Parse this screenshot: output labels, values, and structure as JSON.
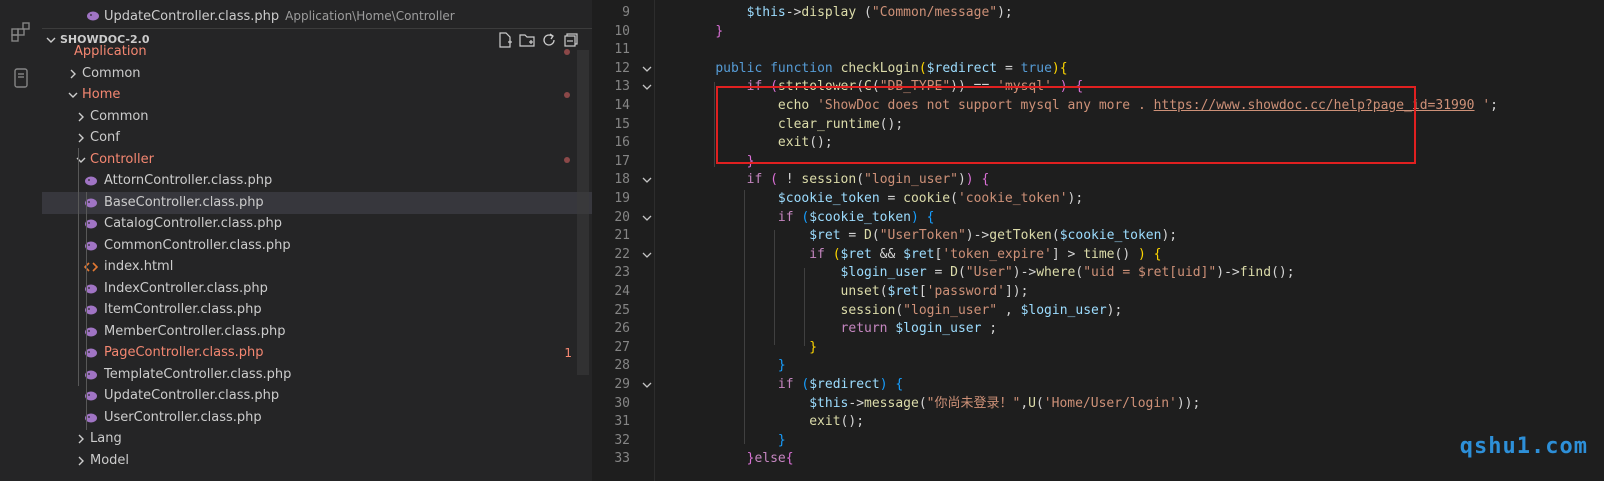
{
  "explorer": {
    "open_editor": {
      "name": "UpdateController.class.php",
      "path": "Application\\Home\\Controller"
    },
    "section_title": "SHOWDOC-2.0",
    "tree": [
      {
        "label": "Application",
        "kind": "folder",
        "state": "partial",
        "error": true
      },
      {
        "label": "Common",
        "kind": "folder",
        "state": "collapsed"
      },
      {
        "label": "Home",
        "kind": "folder",
        "state": "expanded",
        "error": true
      },
      {
        "label": "Common",
        "kind": "folder",
        "state": "collapsed"
      },
      {
        "label": "Conf",
        "kind": "folder",
        "state": "collapsed"
      },
      {
        "label": "Controller",
        "kind": "folder",
        "state": "expanded",
        "error": true
      },
      {
        "label": "AttornController.class.php",
        "kind": "php"
      },
      {
        "label": "BaseController.class.php",
        "kind": "php",
        "selected": true
      },
      {
        "label": "CatalogController.class.php",
        "kind": "php"
      },
      {
        "label": "CommonController.class.php",
        "kind": "php"
      },
      {
        "label": "index.html",
        "kind": "html"
      },
      {
        "label": "IndexController.class.php",
        "kind": "php"
      },
      {
        "label": "ItemController.class.php",
        "kind": "php"
      },
      {
        "label": "MemberController.class.php",
        "kind": "php"
      },
      {
        "label": "PageController.class.php",
        "kind": "php",
        "error": true,
        "badge": "1"
      },
      {
        "label": "TemplateController.class.php",
        "kind": "php"
      },
      {
        "label": "UpdateController.class.php",
        "kind": "php"
      },
      {
        "label": "UserController.class.php",
        "kind": "php"
      },
      {
        "label": "Lang",
        "kind": "folder",
        "state": "collapsed"
      },
      {
        "label": "Model",
        "kind": "folder",
        "state": "collapsed"
      }
    ]
  },
  "editor": {
    "lines": [
      {
        "n": "9",
        "html": "        <span class=\"var\">$this</span>-&gt;<span class=\"fn\">display</span> (<span class=\"str\">\"Common/message\"</span>);"
      },
      {
        "n": "10",
        "html": "    <span class=\"br1\">}</span>"
      },
      {
        "n": "11",
        "html": ""
      },
      {
        "n": "12",
        "html": "    <span class=\"kw\">public</span> <span class=\"kw\">function</span> <span class=\"fn\">checkLogin</span><span class=\"br0\">(</span><span class=\"var\">$redirect</span> = <span class=\"kw\">true</span><span class=\"br0\">)</span><span class=\"br0\">{</span>"
      },
      {
        "n": "13",
        "html": "        <span class=\"ctl\">if</span> <span class=\"br1\">(</span><span class=\"fn\">strtolower</span>(<span class=\"fn\">C</span>(<span class=\"str\">\"DB_TYPE\"</span>)) == <span class=\"str\">'mysql'</span> <span class=\"br1\">)</span> <span class=\"br1\">{</span>"
      },
      {
        "n": "14",
        "html": "            <span class=\"fn\">echo</span> <span class=\"str\">'ShowDoc does not support mysql any more . </span><span class=\"url\">https://www.showdoc.cc/help?page_id=31990</span><span class=\"str\"> '</span>;"
      },
      {
        "n": "15",
        "html": "            <span class=\"fn\">clear_runtime</span>();"
      },
      {
        "n": "16",
        "html": "            <span class=\"fn\">exit</span>();"
      },
      {
        "n": "17",
        "html": "        <span class=\"br1\">}</span>"
      },
      {
        "n": "18",
        "html": "        <span class=\"ctl\">if</span> <span class=\"br1\">(</span> ! <span class=\"fn\">session</span>(<span class=\"str\">\"login_user\"</span>)<span class=\"br1\">)</span> <span class=\"br1\">{</span>"
      },
      {
        "n": "19",
        "html": "            <span class=\"var\">$cookie_token</span> = <span class=\"fn\">cookie</span>(<span class=\"str\">'cookie_token'</span>);"
      },
      {
        "n": "20",
        "html": "            <span class=\"ctl\">if</span> <span class=\"br2\">(</span><span class=\"var\">$cookie_token</span><span class=\"br2\">)</span> <span class=\"br2\">{</span>"
      },
      {
        "n": "21",
        "html": "                <span class=\"var\">$ret</span> = <span class=\"fn\">D</span>(<span class=\"str\">\"UserToken\"</span>)-&gt;<span class=\"fn\">getToken</span>(<span class=\"var\">$cookie_token</span>);"
      },
      {
        "n": "22",
        "html": "                <span class=\"ctl\">if</span> <span class=\"br0\">(</span><span class=\"var\">$ret</span> &amp;&amp; <span class=\"var\">$ret</span>[<span class=\"str\">'token_expire'</span>] &gt; <span class=\"fn\">time</span>() <span class=\"br0\">)</span> <span class=\"br0\">{</span>"
      },
      {
        "n": "23",
        "html": "                    <span class=\"var\">$login_user</span> = <span class=\"fn\">D</span>(<span class=\"str\">\"User\"</span>)-&gt;<span class=\"fn\">where</span>(<span class=\"str\">\"uid = $ret[uid]\"</span>)-&gt;<span class=\"fn\">find</span>();"
      },
      {
        "n": "24",
        "html": "                    <span class=\"fn\">unset</span>(<span class=\"var\">$ret</span>[<span class=\"str\">'password'</span>]);"
      },
      {
        "n": "25",
        "html": "                    <span class=\"fn\">session</span>(<span class=\"str\">\"login_user\"</span> , <span class=\"var\">$login_user</span>);"
      },
      {
        "n": "26",
        "html": "                    <span class=\"ctl\">return</span> <span class=\"var\">$login_user</span> ;"
      },
      {
        "n": "27",
        "html": "                <span class=\"br0\">}</span>"
      },
      {
        "n": "28",
        "html": "            <span class=\"br2\">}</span>"
      },
      {
        "n": "29",
        "html": "            <span class=\"ctl\">if</span> <span class=\"br2\">(</span><span class=\"var\">$redirect</span><span class=\"br2\">)</span> <span class=\"br2\">{</span>"
      },
      {
        "n": "30",
        "html": "                <span class=\"var\">$this</span>-&gt;<span class=\"fn\">message</span>(<span class=\"str\">\"你尚未登录！\"</span>,<span class=\"fn\">U</span>(<span class=\"str\">'Home/User/login'</span>));"
      },
      {
        "n": "31",
        "html": "                <span class=\"fn\">exit</span>();"
      },
      {
        "n": "32",
        "html": "            <span class=\"br2\">}</span>"
      },
      {
        "n": "33",
        "html": "        <span class=\"br1\">}</span><span class=\"ctl\">else</span><span class=\"br1\">{</span>"
      }
    ],
    "foldable_lines": [
      "12",
      "13",
      "18",
      "20",
      "22",
      "29"
    ]
  },
  "watermark": "qshu1.com",
  "colors": {
    "highlight_box": "#e02020",
    "error_text": "#f48771",
    "watermark": "#2d8fd8"
  }
}
